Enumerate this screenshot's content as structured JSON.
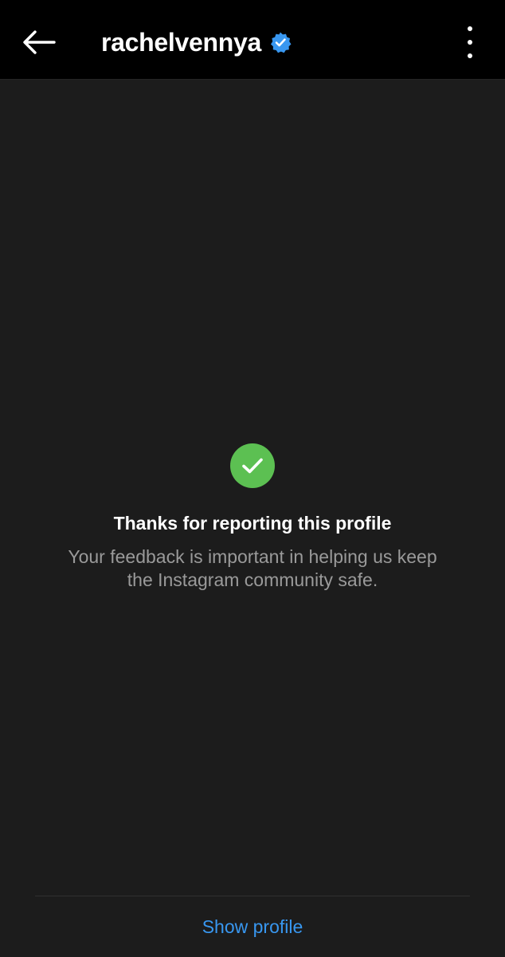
{
  "header": {
    "username": "rachelvennya",
    "back_icon": "arrow-left-icon",
    "verified_icon": "verified-badge-icon",
    "more_icon": "vertical-ellipsis-icon"
  },
  "confirmation": {
    "icon": "check-circle-icon",
    "title": "Thanks for reporting this profile",
    "message": "Your feedback is important in helping us keep the Instagram community safe."
  },
  "footer": {
    "show_profile_label": "Show profile"
  },
  "colors": {
    "background": "#1c1c1c",
    "topbar": "#000000",
    "success_green": "#5cc052",
    "verified_blue": "#3897f0",
    "link_blue": "#3897f0",
    "secondary_text": "#9a9a9a"
  }
}
